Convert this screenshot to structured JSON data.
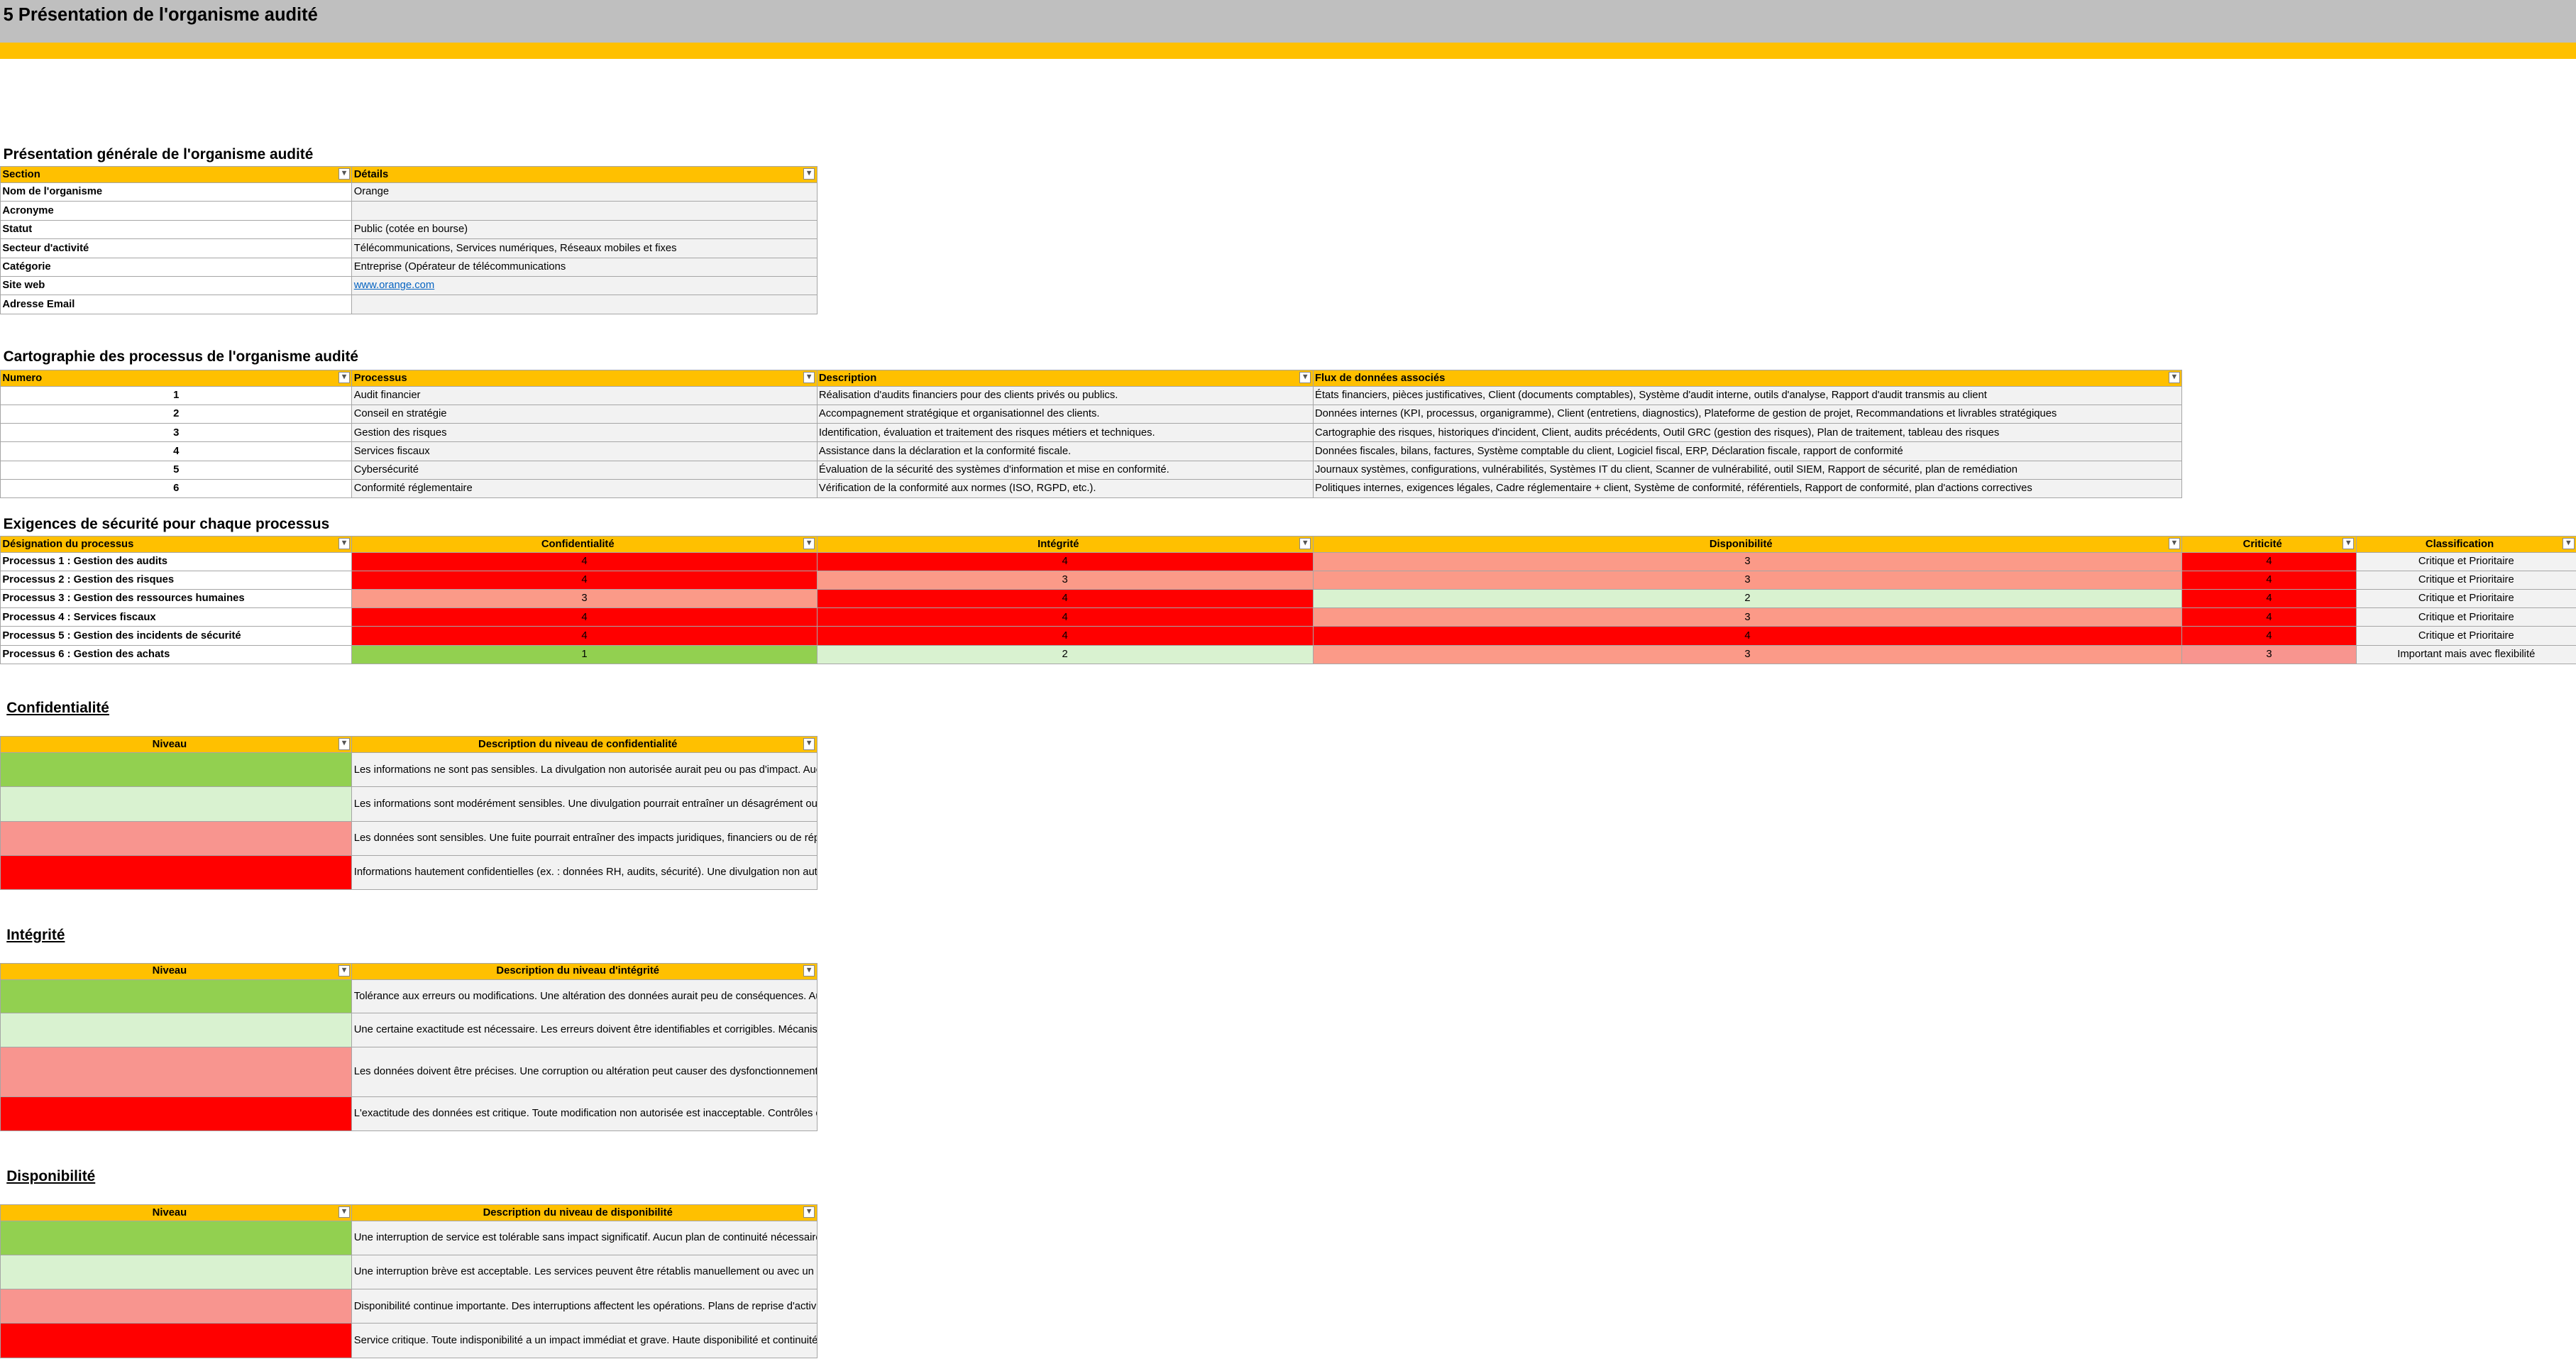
{
  "header": {
    "title": "5 Présentation de l'organisme audité"
  },
  "org": {
    "title": "Présentation générale de l'organisme audité",
    "headers": [
      "Section",
      "Détails"
    ],
    "rows": [
      {
        "label": "Nom de l'organisme",
        "value": "Orange"
      },
      {
        "label": "Acronyme",
        "value": ""
      },
      {
        "label": "Statut",
        "value": "Public (cotée en bourse)"
      },
      {
        "label": "Secteur d'activité",
        "value": "Télécommunications, Services numériques, Réseaux mobiles et fixes"
      },
      {
        "label": "Catégorie",
        "value": "Entreprise (Opérateur de télécommunications"
      },
      {
        "label": "Site web",
        "value": "www.orange.com"
      },
      {
        "label": "Adresse Email",
        "value": ""
      }
    ]
  },
  "processes": {
    "title": "Cartographie des processus de l'organisme audité",
    "headers": [
      "Numero",
      "Processus",
      "Description",
      "Flux de données associés"
    ],
    "rows": [
      {
        "num": "1",
        "name": "Audit financier",
        "desc": "Réalisation d'audits financiers pour des clients privés ou publics.",
        "flows": "États financiers, pièces justificatives, Client (documents comptables), Système d'audit interne, outils d'analyse, Rapport d'audit transmis au client"
      },
      {
        "num": "2",
        "name": "Conseil en stratégie",
        "desc": "Accompagnement stratégique et organisationnel des clients.",
        "flows": "Données internes (KPI, processus, organigramme), Client (entretiens, diagnostics), Plateforme de gestion de projet, Recommandations et livrables stratégiques"
      },
      {
        "num": "3",
        "name": "Gestion des risques",
        "desc": "Identification, évaluation et traitement des risques métiers et techniques.",
        "flows": "Cartographie des risques, historiques d'incident, Client, audits précédents, Outil GRC (gestion des risques), Plan de traitement, tableau des risques"
      },
      {
        "num": "4",
        "name": "Services fiscaux",
        "desc": "Assistance dans la déclaration et la conformité fiscale.",
        "flows": "Données fiscales, bilans, factures, Système comptable du client, Logiciel fiscal, ERP, Déclaration fiscale, rapport de conformité"
      },
      {
        "num": "5",
        "name": "Cybersécurité",
        "desc": "Évaluation de la sécurité des systèmes d'information et mise en conformité.",
        "flows": "Journaux systèmes, configurations, vulnérabilités, Systèmes IT du client, Scanner de vulnérabilité, outil SIEM, Rapport de sécurité, plan de remédiation"
      },
      {
        "num": "6",
        "name": "Conformité réglementaire",
        "desc": "Vérification de la conformité aux normes (ISO, RGPD, etc.).",
        "flows": "Politiques internes, exigences légales, Cadre réglementaire + client, Système de conformité, référentiels, Rapport de conformité, plan d'actions correctives"
      }
    ]
  },
  "security": {
    "title": "Exigences de sécurité pour chaque processus",
    "headers": [
      "Désignation du processus",
      "Confidentialité",
      "Intégrité",
      "Disponibilité",
      "Criticité",
      "Classification"
    ],
    "rows": [
      {
        "name": "Processus 1 : Gestion des audits",
        "c": "4",
        "i": "4",
        "d": "3",
        "crit": "4",
        "cls": "Critique et Prioritaire"
      },
      {
        "name": "Processus 2 : Gestion des risques",
        "c": "4",
        "i": "3",
        "d": "3",
        "crit": "4",
        "cls": "Critique et Prioritaire"
      },
      {
        "name": "Processus 3 : Gestion des ressources humaines",
        "c": "3",
        "i": "4",
        "d": "2",
        "crit": "4",
        "cls": "Critique et Prioritaire"
      },
      {
        "name": "Processus 4 : Services fiscaux",
        "c": "4",
        "i": "4",
        "d": "3",
        "crit": "4",
        "cls": "Critique et Prioritaire"
      },
      {
        "name": "Processus 5 : Gestion des incidents de sécurité",
        "c": "4",
        "i": "4",
        "d": "4",
        "crit": "4",
        "cls": "Critique et Prioritaire"
      },
      {
        "name": "Processus 6 : Gestion des achats",
        "c": "1",
        "i": "2",
        "d": "3",
        "crit": "3",
        "cls": "Important mais avec flexibilité"
      }
    ],
    "colors": {
      "level1": "#92d050",
      "level2": "#d9f2d0",
      "level3": "#f8958f",
      "level4": "#ff0000"
    }
  },
  "confid": {
    "title": "Confidentialité",
    "headers": [
      "Niveau",
      "Description du niveau de confidentialité"
    ],
    "rows": [
      "Les informations ne sont pas sensibles. La divulgation non autorisée aurait peu ou pas d'impact. Aucun contrôle d'accès strict requis.",
      "Les informations sont modérément sensibles. Une divulgation pourrait entraîner un désagrément ou un impact limité sur l'organisation. Accès contrôlé recommandé.",
      "Les données sont sensibles. Une fuite pourrait entraîner des impacts juridiques, financiers ou de réputation. Des contrôles d'accès renforcés sont nécessaires.",
      "Informations hautement confidentielles (ex. : données RH, audits, sécurité). Une divulgation non autorisée aurait un impact majeur. Accès strictement limité et chiffré."
    ]
  },
  "integ": {
    "title": "Intégrité",
    "headers": [
      "Niveau",
      "Description du niveau d'intégrité"
    ],
    "rows": [
      "Tolérance aux erreurs ou modifications. Une altération des données aurait peu de conséquences. Aucun mécanisme de vérification requis.",
      "Une certaine exactitude est nécessaire. Les erreurs doivent être identifiables et corrigibles. Mécanismes de validation de base.",
      "Les données doivent être précises. Une corruption ou altération peut causer des dysfonctionnements ou des erreurs de traitement. Mécanismes de contrôle robustes requis.",
      "L'exactitude des données est critique. Toute modification non autorisée est inacceptable. Contrôles d'intégrité cryptographiques et traçabilité sont indispensables."
    ]
  },
  "dispo": {
    "title": "Disponibilité",
    "headers": [
      "Niveau",
      "Description du niveau de disponibilité"
    ],
    "rows": [
      "Une interruption de service est tolérable sans impact significatif. Aucun plan de continuité nécessaire.",
      "Une interruption brève est acceptable. Les services peuvent être rétablis manuellement ou avec un délai modéré.",
      "Disponibilité continue importante. Des interruptions affectent les opérations. Plans de reprise d'activité recommandés.",
      "Service critique. Toute indisponibilité a un impact immédiat et grave. Haute disponibilité et continuité d'activité obligatoire."
    ]
  }
}
